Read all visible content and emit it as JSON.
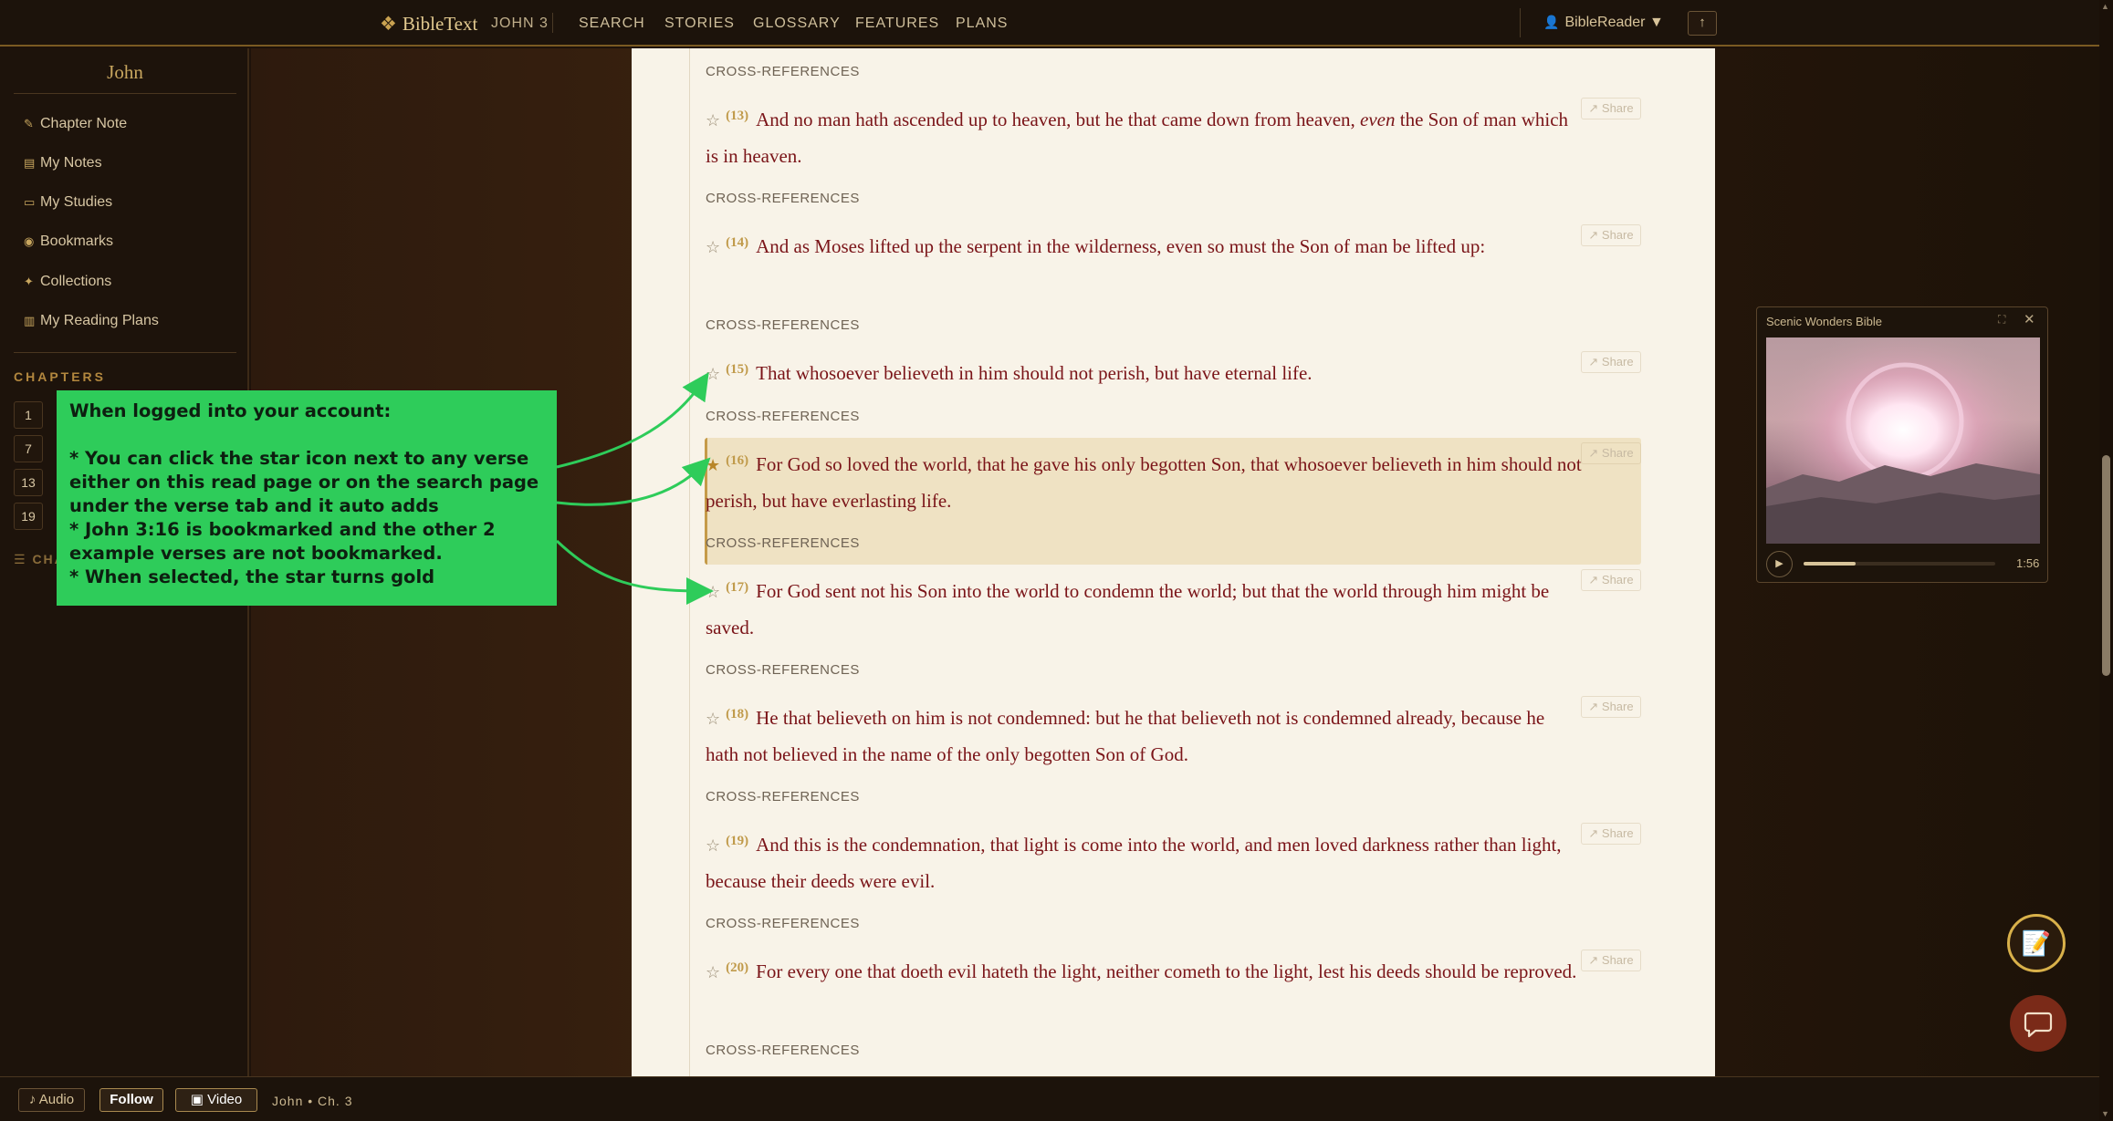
{
  "header": {
    "brand": "BibleText",
    "crumb": "JOHN 3",
    "nav": [
      "SEARCH",
      "STORIES",
      "GLOSSARY",
      "FEATURES",
      "PLANS"
    ],
    "user": "BibleReader ▼",
    "up": "↑"
  },
  "sidebar": {
    "title": "John",
    "items": [
      {
        "icon": "pencil-icon",
        "glyph": "✎",
        "label": "Chapter Note"
      },
      {
        "icon": "note-icon",
        "glyph": "▤",
        "label": "My Notes"
      },
      {
        "icon": "book-icon",
        "glyph": "▭",
        "label": "My Studies"
      },
      {
        "icon": "bookmark-icon",
        "glyph": "◉",
        "label": "Bookmarks"
      },
      {
        "icon": "sparkle-icon",
        "glyph": "✦",
        "label": "Collections"
      },
      {
        "icon": "books-icon",
        "glyph": "▥",
        "label": "My Reading Plans"
      }
    ],
    "chapters_heading": "CHAPTERS",
    "chapters": [
      "1",
      "7",
      "13",
      "19"
    ],
    "cha_label": "☰ CHA"
  },
  "reader": {
    "crossref_label": "CROSS-REFERENCES",
    "share_label": "↗ Share",
    "verses": [
      {
        "num": "(13)",
        "pre": "And no man hath ascended up to heaven, but he that came down from heaven, ",
        "em": "even",
        "post": " the Son of man which is in heaven.",
        "bookmarked": false
      },
      {
        "num": "(14)",
        "pre": "And as Moses lifted up the serpent in the wilderness, even so must the Son of man be lifted up:",
        "em": "",
        "post": "",
        "bookmarked": false
      },
      {
        "num": "(15)",
        "pre": "That whosoever believeth in him should not perish, but have eternal life.",
        "em": "",
        "post": "",
        "bookmarked": false
      },
      {
        "num": "(16)",
        "pre": "For God so loved the world, that he gave his only begotten Son, that whosoever believeth in him should not perish, but have everlasting life.",
        "em": "",
        "post": "",
        "bookmarked": true
      },
      {
        "num": "(17)",
        "pre": "For God sent not his Son into the world to condemn the world; but that the world through him might be saved.",
        "em": "",
        "post": "",
        "bookmarked": false
      },
      {
        "num": "(18)",
        "pre": "He that believeth on him is not condemned: but he that believeth not is condemned already, because he hath not believed in the name of the only begotten Son of God.",
        "em": "",
        "post": "",
        "bookmarked": false
      },
      {
        "num": "(19)",
        "pre": "And this is the condemnation, that light is come into the world, and men loved darkness rather than light, because their deeds were evil.",
        "em": "",
        "post": "",
        "bookmarked": false
      },
      {
        "num": "(20)",
        "pre": "For every one that doeth evil hateth the light, neither cometh to the light, lest his deeds should be reproved.",
        "em": "",
        "post": "",
        "bookmarked": false
      }
    ]
  },
  "annotation": {
    "text": "When logged into your account:\n\n* You can click the star icon next to any verse either on this read page or on the search page under the verse tab and it auto adds\n* John 3:16 is bookmarked and the other 2 example verses are not bookmarked.\n* When selected, the star turns gold",
    "color": "#2ecc5a"
  },
  "video": {
    "title": "Scenic Wonders Bible",
    "time": "1:56",
    "progress": 0.27
  },
  "footer": {
    "audio": "♪ Audio",
    "follow": "Follow",
    "video": "▣ Video",
    "label": "John • Ch. 3"
  },
  "colors": {
    "accent": "#c9a251",
    "verse_text": "#7a1418",
    "star_gold": "#b8862a"
  }
}
